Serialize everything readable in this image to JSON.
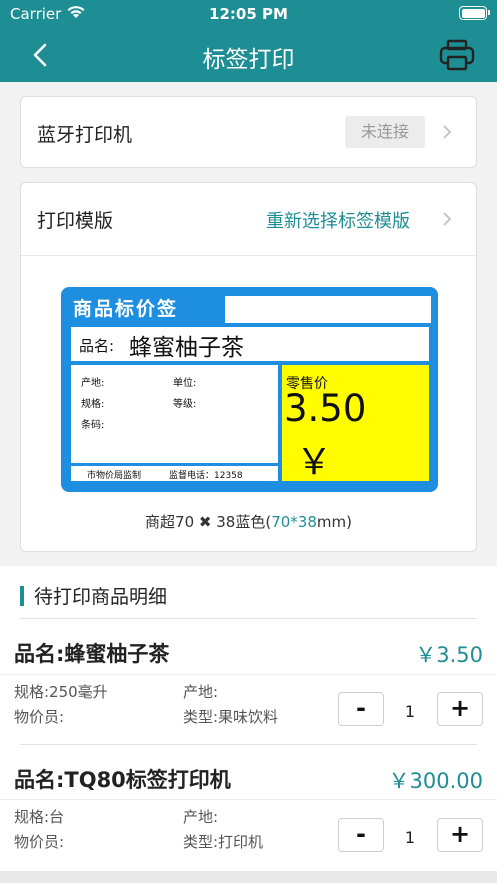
{
  "status_bar": {
    "carrier": "Carrier",
    "time": "12:05 PM"
  },
  "nav": {
    "title": "标签打印"
  },
  "bluetooth": {
    "label": "蓝牙打印机",
    "status": "未连接"
  },
  "template": {
    "label": "打印模版",
    "action": "重新选择标签模版",
    "preview": {
      "title": "商品标价签",
      "name_label": "品名:",
      "name_value": "蜂蜜柚子茶",
      "origin": "产地:",
      "unit": "单位:",
      "spec": "规格:",
      "grade": "等级:",
      "barcode": "条码:",
      "price_label": "零售价",
      "price_value": "3.50",
      "currency": "￥",
      "footer_left": "市物价局监制",
      "footer_right": "监督电话：12358"
    },
    "caption_prefix": "商超70 ✖ 38蓝色(",
    "caption_size": "70*38",
    "caption_suffix": "mm)"
  },
  "section": {
    "title": "待打印商品明细"
  },
  "products": [
    {
      "name": "品名:蜂蜜柚子茶",
      "price": "￥3.50",
      "spec": "规格:250毫升",
      "origin": "产地:",
      "staff": "物价员:",
      "type": "类型:果味饮料",
      "minus": "-",
      "qty": "1",
      "plus": "+"
    },
    {
      "name": "品名:TQ80标签打印机",
      "price": "￥300.00",
      "spec": "规格:台",
      "origin": "产地:",
      "staff": "物价员:",
      "type": "类型:打印机",
      "minus": "-",
      "qty": "1",
      "plus": "+"
    }
  ],
  "colors": {
    "accent": "#1e8e95",
    "label_blue": "#1e8fe0",
    "price_yellow": "#fffd00"
  }
}
